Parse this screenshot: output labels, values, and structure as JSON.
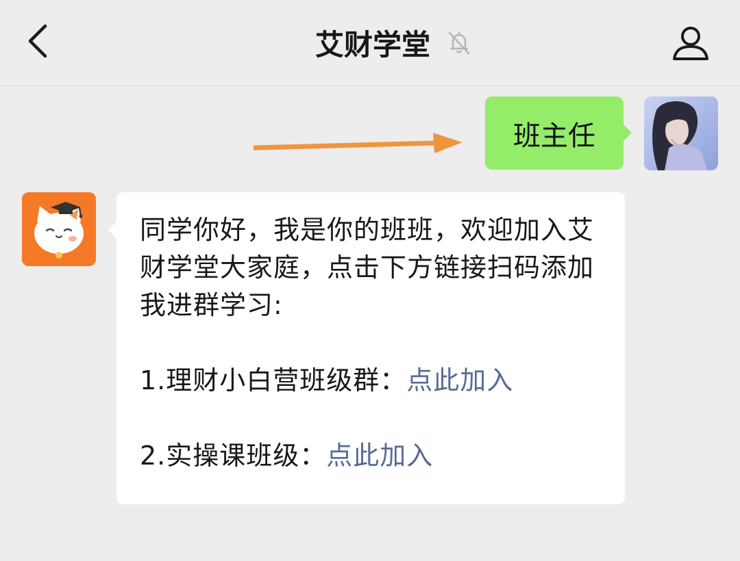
{
  "header": {
    "title": "艾财学堂",
    "back_icon": "chevron-left-icon",
    "mute_icon": "bell-off-icon",
    "profile_icon": "person-icon"
  },
  "messages": {
    "outgoing": {
      "text": "班主任",
      "bubble_color": "#95ec69"
    },
    "incoming": {
      "intro": "同学你好，我是你的班班，欢迎加入艾财学堂大家庭，点击下方链接扫码添加我进群学习:",
      "item1_label": "1.理财小白营班级群：",
      "item1_link": "点此加入",
      "item2_label": "2.实操课班级：",
      "item2_link": "点此加入",
      "link_color": "#576b95"
    }
  },
  "annotation": {
    "arrow_color": "#f0953f"
  }
}
